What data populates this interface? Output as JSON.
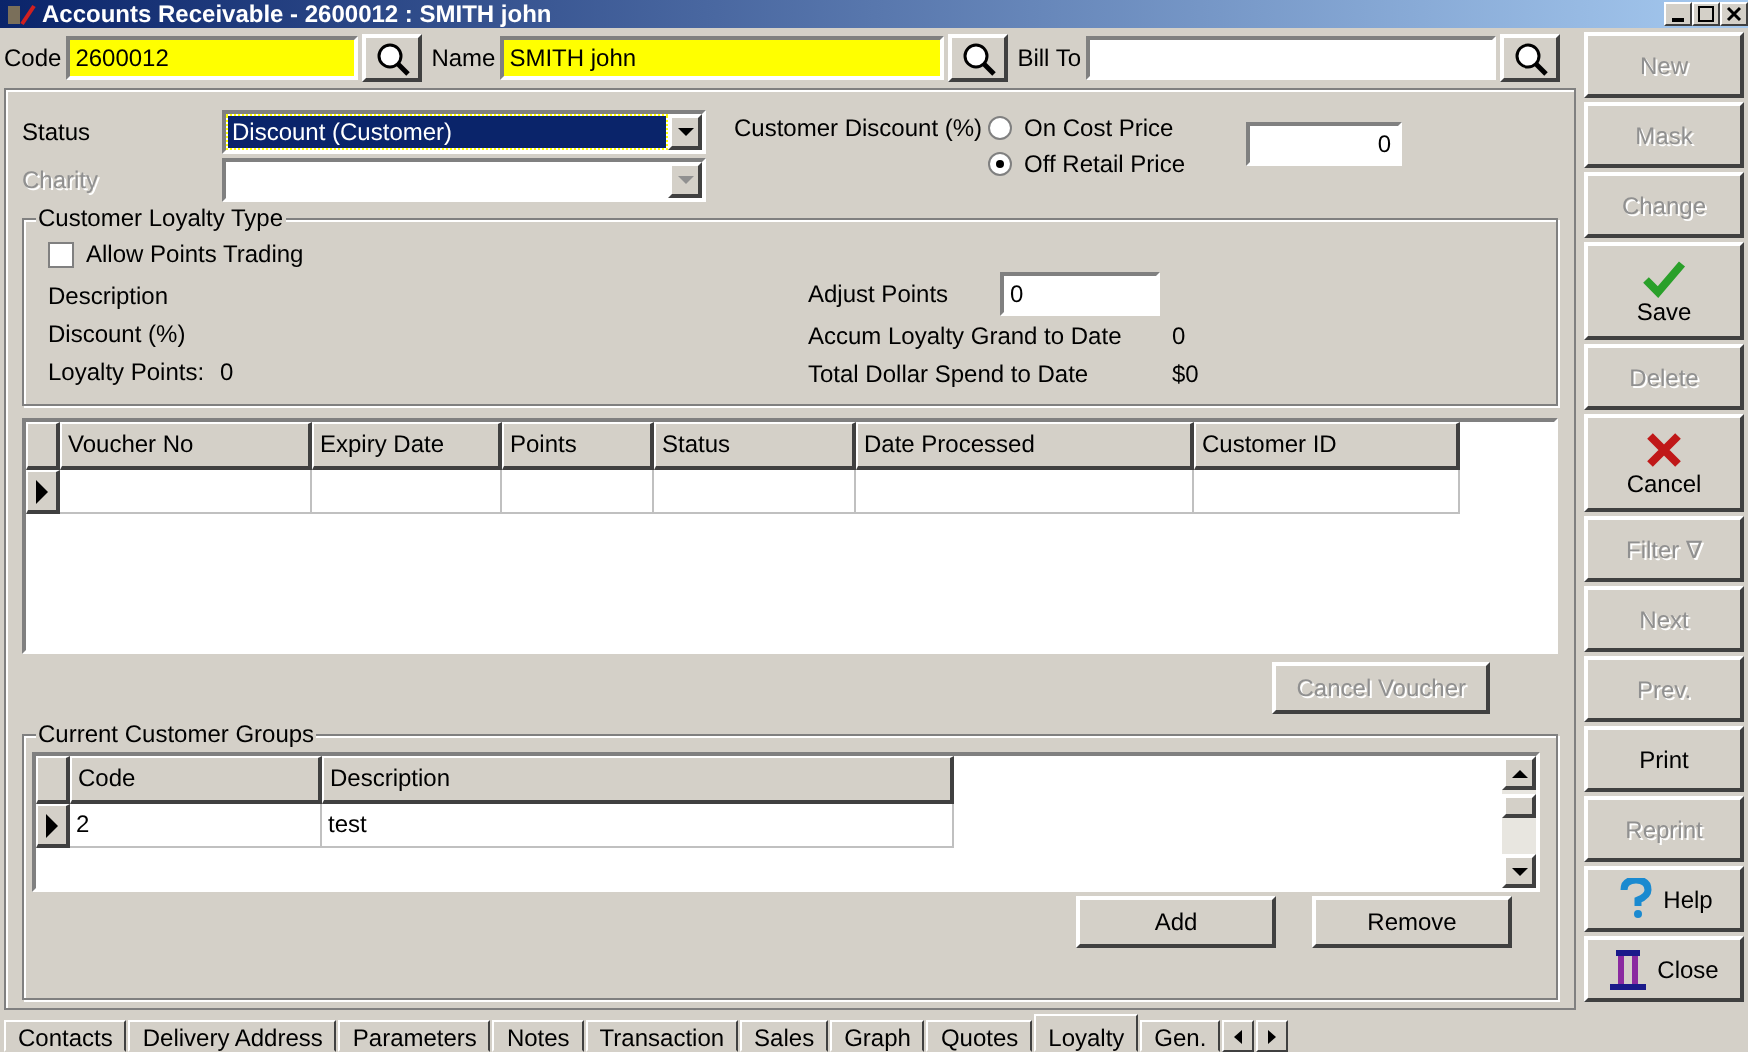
{
  "window": {
    "title": "Accounts Receivable - 2600012 : SMITH john"
  },
  "header_fields": [
    {
      "label": "Code",
      "value": "2600012",
      "highlighted": true
    },
    {
      "label": "Name",
      "value": "SMITH john",
      "highlighted": true
    },
    {
      "label": "Bill To",
      "highlighted": false
    }
  ],
  "status": {
    "label": "Status",
    "value": "Discount (Customer)",
    "focused": true
  },
  "charity": {
    "label": "Charity",
    "disabled": true
  },
  "customer_discount": {
    "label": "Customer Discount (%)",
    "value": "0",
    "options": [
      {
        "label": "On Cost Price",
        "selected": false
      },
      {
        "label": "Off Retail Price",
        "selected": true
      }
    ]
  },
  "loyalty": {
    "title": "Customer Loyalty Type",
    "allow_points_trading": {
      "label": "Allow Points Trading",
      "checked": false
    },
    "left": [
      {
        "label": "Description"
      },
      {
        "label": "Discount (%)"
      },
      {
        "label": "Loyalty Points:",
        "value": "0"
      }
    ],
    "right": [
      {
        "label": "Adjust Points",
        "kind": "input",
        "value": "0"
      },
      {
        "label": "Accum Loyalty Grand to Date",
        "kind": "text",
        "value": "0"
      },
      {
        "label": "Total Dollar Spend to Date",
        "kind": "text",
        "value": "$0"
      }
    ]
  },
  "vouchers": {
    "columns": [
      "Voucher No",
      "Expiry Date",
      "Points",
      "Status",
      "Date Processed",
      "Customer ID"
    ],
    "rows": [
      {
        "current": true
      }
    ]
  },
  "cancel_voucher": {
    "label": "Cancel Voucher",
    "disabled": true
  },
  "groups": {
    "title": "Current Customer Groups",
    "columns": [
      "Code",
      "Description"
    ],
    "rows": [
      {
        "current": true,
        "cells": [
          "2",
          "test"
        ]
      }
    ],
    "buttons": [
      {
        "label": "Add"
      },
      {
        "label": "Remove"
      }
    ]
  },
  "tabs": [
    {
      "label": "Contacts",
      "selected": false
    },
    {
      "label": "Delivery Address",
      "selected": false
    },
    {
      "label": "Parameters",
      "selected": false
    },
    {
      "label": "Notes",
      "selected": false
    },
    {
      "label": "Transaction",
      "selected": false
    },
    {
      "label": "Sales",
      "selected": false
    },
    {
      "label": "Graph",
      "selected": false
    },
    {
      "label": "Quotes",
      "selected": false
    },
    {
      "label": "Loyalty",
      "selected": true
    },
    {
      "label": "Gen.",
      "selected": false
    }
  ],
  "side_buttons": [
    {
      "label": "New",
      "disabled": true,
      "kind": "plain"
    },
    {
      "label": "Mask",
      "disabled": true,
      "kind": "plain"
    },
    {
      "label": "Change",
      "disabled": true,
      "kind": "plain"
    },
    {
      "label": "Save",
      "disabled": false,
      "kind": "check"
    },
    {
      "label": "Delete",
      "disabled": true,
      "kind": "plain"
    },
    {
      "label": "Cancel",
      "disabled": false,
      "kind": "cross"
    },
    {
      "label": "Filter ∇",
      "disabled": true,
      "kind": "plain"
    },
    {
      "label": "Next",
      "disabled": true,
      "kind": "plain"
    },
    {
      "label": "Prev.",
      "disabled": true,
      "kind": "plain"
    },
    {
      "label": "Print",
      "disabled": false,
      "kind": "plain"
    },
    {
      "label": "Reprint",
      "disabled": true,
      "kind": "plain"
    },
    {
      "label": "Help",
      "disabled": false,
      "kind": "help"
    },
    {
      "label": "Close",
      "disabled": false,
      "kind": "door"
    }
  ]
}
